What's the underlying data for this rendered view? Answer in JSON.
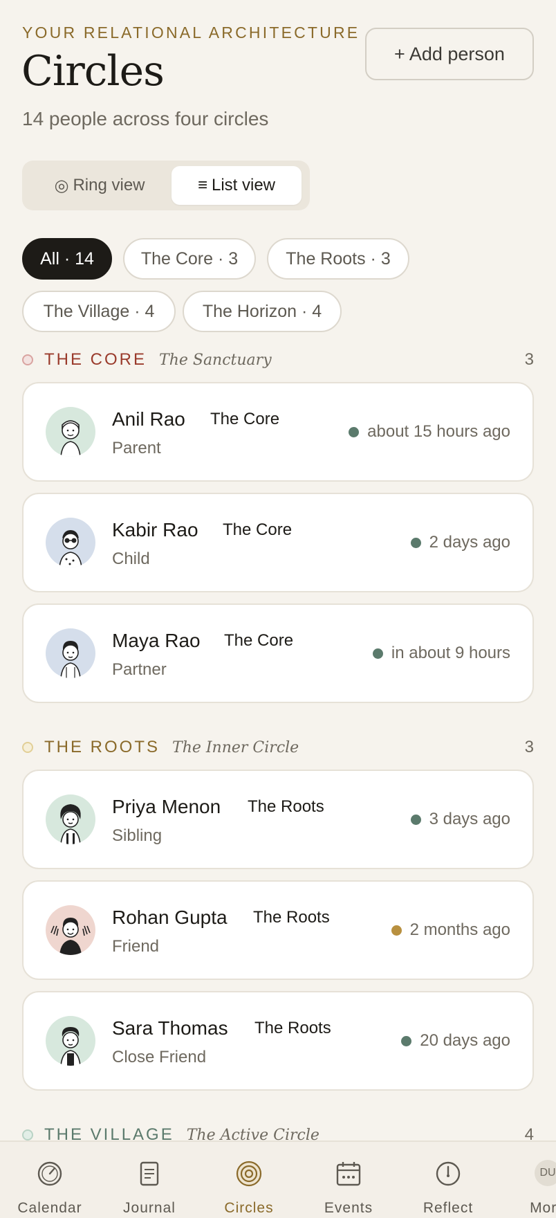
{
  "header": {
    "eyebrow": "YOUR RELATIONAL ARCHITECTURE",
    "title": "Circles",
    "subtitle": "14 people across four circles",
    "add_button": "+ Add person"
  },
  "view_toggle": {
    "ring_icon": "◎",
    "ring_label": "Ring view",
    "list_icon": "≡",
    "list_label": "List view",
    "selected": "List view"
  },
  "filters": [
    {
      "label": "All · 14",
      "active": true
    },
    {
      "label": "The Core · 3",
      "active": false
    },
    {
      "label": "The Roots · 3",
      "active": false
    },
    {
      "label": "The Village · 4",
      "active": false
    },
    {
      "label": "The Horizon · 4",
      "active": false
    }
  ],
  "sections": [
    {
      "title": "THE CORE",
      "subtitle": "The Sanctuary",
      "count": "3",
      "color": "#9a3b2c",
      "dot_color": "#d9a3a0",
      "people": [
        {
          "name": "Anil Rao",
          "ring": "The Core",
          "relation": "Parent",
          "last_seen": "about 15 hours ago",
          "status_color": "#5b7a6c",
          "avatar_bg": "#d7e8dd"
        },
        {
          "name": "Kabir Rao",
          "ring": "The Core",
          "relation": "Child",
          "last_seen": "2 days ago",
          "status_color": "#5b7a6c",
          "avatar_bg": "#d5deeb"
        },
        {
          "name": "Maya Rao",
          "ring": "The Core",
          "relation": "Partner",
          "last_seen": "in about 9 hours",
          "status_color": "#5b7a6c",
          "avatar_bg": "#d5deeb"
        }
      ]
    },
    {
      "title": "THE ROOTS",
      "subtitle": "The Inner Circle",
      "count": "3",
      "color": "#8a6a2a",
      "dot_color": "#e2cf96",
      "people": [
        {
          "name": "Priya Menon",
          "ring": "The Roots",
          "relation": "Sibling",
          "last_seen": "3 days ago",
          "status_color": "#5b7a6c",
          "avatar_bg": "#d7e8dd"
        },
        {
          "name": "Rohan Gupta",
          "ring": "The Roots",
          "relation": "Friend",
          "last_seen": "2 months ago",
          "status_color": "#b8903f",
          "avatar_bg": "#efd6cf"
        },
        {
          "name": "Sara Thomas",
          "ring": "The Roots",
          "relation": "Close Friend",
          "last_seen": "20 days ago",
          "status_color": "#5b7a6c",
          "avatar_bg": "#d7e8dd"
        }
      ]
    },
    {
      "title": "THE VILLAGE",
      "subtitle": "The Active Circle",
      "count": "4",
      "color": "#5b7a6c",
      "dot_color": "#b9d3c5",
      "people": []
    }
  ],
  "tabbar": [
    {
      "label": "Calendar",
      "icon": "calendar-clock-icon",
      "active": false
    },
    {
      "label": "Journal",
      "icon": "journal-icon",
      "active": false
    },
    {
      "label": "Circles",
      "icon": "circles-icon",
      "active": true
    },
    {
      "label": "Events",
      "icon": "events-icon",
      "active": false
    },
    {
      "label": "Reflect",
      "icon": "reflect-icon",
      "active": false
    },
    {
      "label": "More",
      "icon": "more-avatar",
      "active": false,
      "initials": "DU"
    }
  ]
}
